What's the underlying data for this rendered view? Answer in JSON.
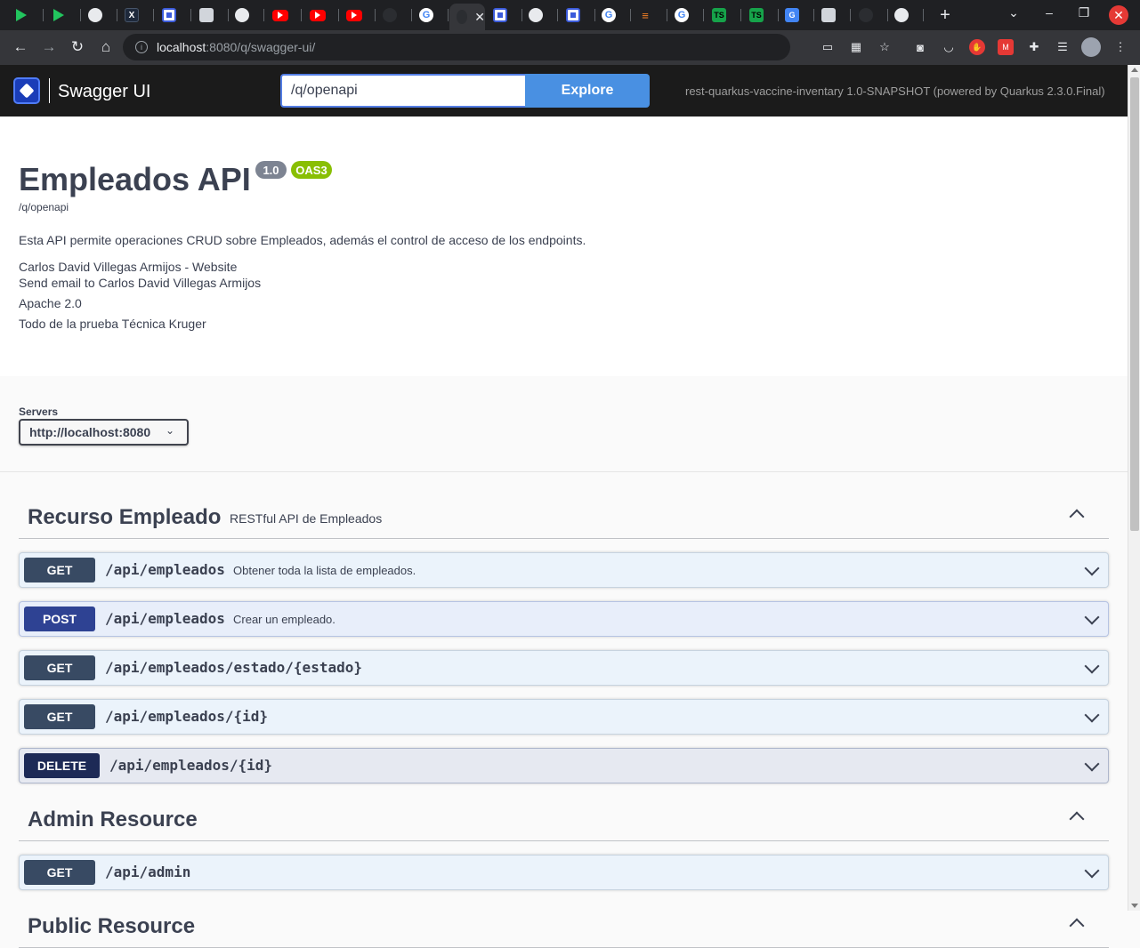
{
  "browser": {
    "tabs": [
      {
        "icon": "play-store-icon",
        "glyph": "",
        "cls": "play"
      },
      {
        "icon": "play-store-icon",
        "glyph": "",
        "cls": "play"
      },
      {
        "icon": "globe-icon",
        "glyph": "",
        "cls": "globe"
      },
      {
        "icon": "app-icon",
        "glyph": "X",
        "cls": "q"
      },
      {
        "icon": "swagger-icon",
        "glyph": "",
        "cls": "sw"
      },
      {
        "icon": "cloud-icon",
        "glyph": "",
        "cls": "av"
      },
      {
        "icon": "globe-icon",
        "glyph": "",
        "cls": "globe"
      },
      {
        "icon": "youtube-icon",
        "glyph": "",
        "cls": "yt"
      },
      {
        "icon": "youtube-icon",
        "glyph": "",
        "cls": "yt"
      },
      {
        "icon": "youtube-icon",
        "glyph": "",
        "cls": "yt"
      },
      {
        "icon": "github-icon",
        "glyph": "",
        "cls": "gh"
      },
      {
        "icon": "google-icon",
        "glyph": "G",
        "cls": "g"
      },
      {
        "icon": "loading-icon",
        "glyph": "",
        "cls": "gh"
      },
      {
        "icon": "swagger-icon",
        "glyph": "",
        "cls": "sw"
      },
      {
        "icon": "globe-icon",
        "glyph": "",
        "cls": "globe"
      },
      {
        "icon": "swagger-icon",
        "glyph": "",
        "cls": "sw"
      },
      {
        "icon": "google-icon",
        "glyph": "G",
        "cls": "g"
      },
      {
        "icon": "stackoverflow-icon",
        "glyph": "≡",
        "cls": "so"
      },
      {
        "icon": "google-icon",
        "glyph": "G",
        "cls": "g"
      },
      {
        "icon": "terminal-icon",
        "glyph": "TS",
        "cls": "ts"
      },
      {
        "icon": "terminal-icon",
        "glyph": "TS",
        "cls": "ts"
      },
      {
        "icon": "translate-icon",
        "glyph": "G",
        "cls": "gt"
      },
      {
        "icon": "avatar-icon",
        "glyph": "",
        "cls": "av"
      },
      {
        "icon": "github-icon",
        "glyph": "",
        "cls": "gh"
      },
      {
        "icon": "chrome-icon",
        "glyph": "",
        "cls": "ch"
      }
    ],
    "address_host": "localhost",
    "address_rest": ":8080/q/swagger-ui/"
  },
  "swagger": {
    "brand": "Swagger UI",
    "spec_input": "/q/openapi",
    "explore_label": "Explore",
    "powered_by": "rest-quarkus-vaccine-inventary 1.0-SNAPSHOT (powered by Quarkus 2.3.0.Final)"
  },
  "info": {
    "title": "Empleados API",
    "version": "1.0",
    "oas": "OAS3",
    "spec_url": "/q/openapi",
    "description": "Esta API permite operaciones CRUD sobre Empleados, además el control de acceso de los endpoints.",
    "contact_website": "Carlos David Villegas Armijos - Website",
    "contact_email": "Send email to Carlos David Villegas Armijos",
    "license": "Apache 2.0",
    "terms": "Todo de la prueba Técnica Kruger"
  },
  "servers": {
    "label": "Servers",
    "selected": "http://localhost:8080"
  },
  "tags": [
    {
      "name": "Recurso Empleado",
      "description": "RESTful API de Empleados",
      "operations": [
        {
          "method": "GET",
          "path": "/api/empleados",
          "summary": "Obtener toda la lista de empleados."
        },
        {
          "method": "POST",
          "path": "/api/empleados",
          "summary": "Crear un empleado."
        },
        {
          "method": "GET",
          "path": "/api/empleados/estado/{estado}",
          "summary": ""
        },
        {
          "method": "GET",
          "path": "/api/empleados/{id}",
          "summary": ""
        },
        {
          "method": "DELETE",
          "path": "/api/empleados/{id}",
          "summary": ""
        }
      ]
    },
    {
      "name": "Admin Resource",
      "description": "",
      "operations": [
        {
          "method": "GET",
          "path": "/api/admin",
          "summary": ""
        }
      ]
    },
    {
      "name": "Public Resource",
      "description": "",
      "operations": []
    }
  ]
}
